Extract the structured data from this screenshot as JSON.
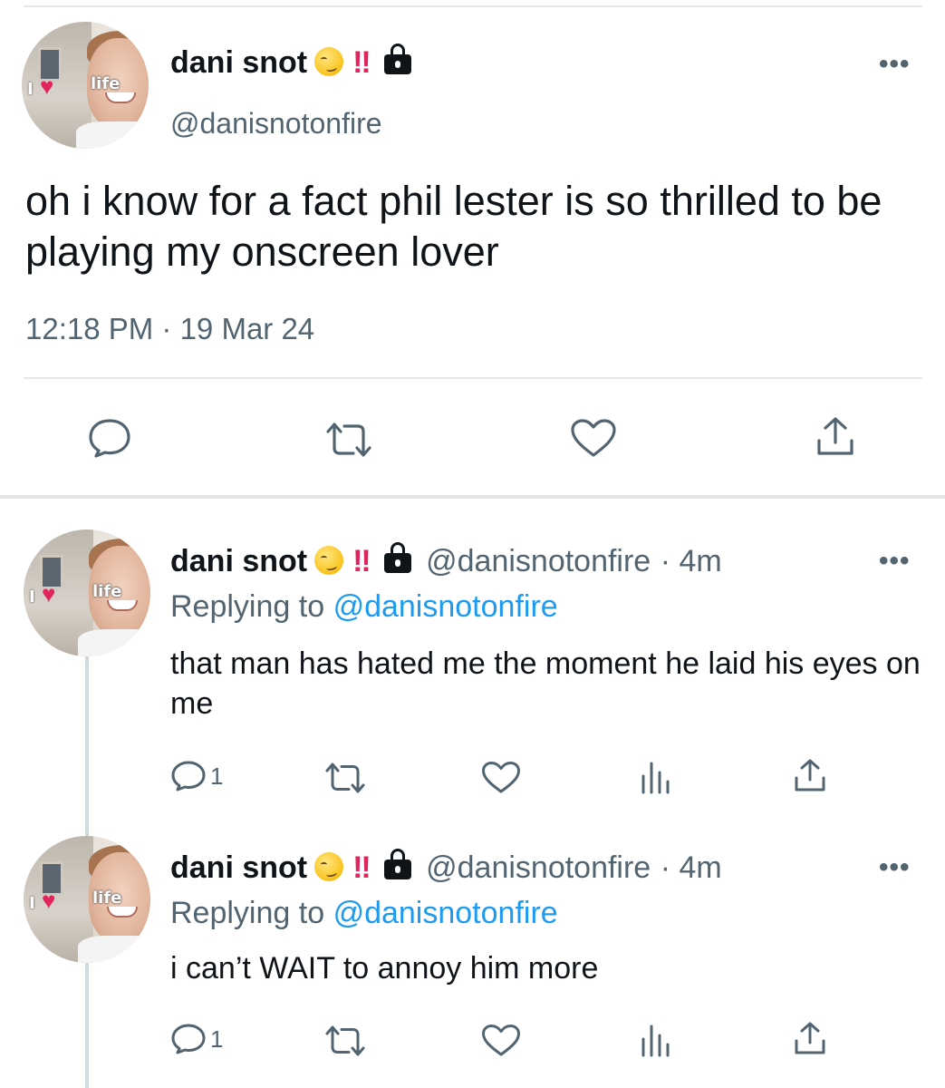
{
  "main_tweet": {
    "display_name": "dani snot",
    "badges": "‼",
    "handle": "@danisnotonfire",
    "text": "oh i know for a fact phil lester is so thrilled to be playing my onscreen lover",
    "timestamp": "12:18 PM · 19 Mar 24",
    "avatar_text": {
      "left": "I",
      "right": "life"
    }
  },
  "replies": [
    {
      "display_name": "dani snot",
      "badges": "‼",
      "handle": "@danisnotonfire",
      "age": "· 4m",
      "replying_prefix": "Replying to",
      "replying_to": "@danisnotonfire",
      "text": "that man has hated me the moment he laid his eyes on me",
      "reply_count": "1",
      "avatar_text": {
        "left": "I",
        "right": "life"
      }
    },
    {
      "display_name": "dani snot",
      "badges": "‼",
      "handle": "@danisnotonfire",
      "age": "· 4m",
      "replying_prefix": "Replying to",
      "replying_to": "@danisnotonfire",
      "text": "i can’t WAIT to annoy him more",
      "reply_count": "1",
      "avatar_text": {
        "left": "I",
        "right": "life"
      }
    }
  ],
  "icons": {
    "reply": "speech-bubble-icon",
    "retweet": "retweet-arrows-icon",
    "like": "heart-icon",
    "share": "share-upload-icon",
    "analytics": "analytics-bars-icon",
    "more": "more-dots-icon",
    "lock": "lock-icon",
    "emoji": "smirking-face-emoji"
  },
  "colors": {
    "accent": "#1d9bf0",
    "secondary_text": "#536471",
    "bangbang": "#e0245e",
    "heart_avatar": "#e0245e"
  }
}
